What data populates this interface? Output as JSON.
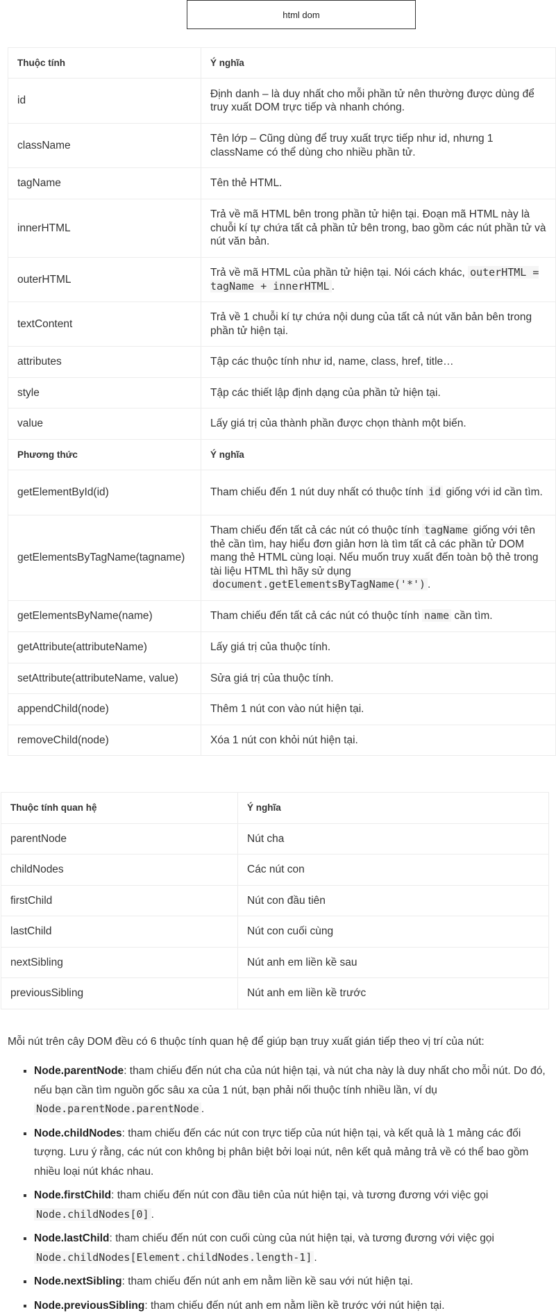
{
  "title": "html dom",
  "table1": {
    "header_props": [
      "Thuộc tính",
      "Ý nghĩa"
    ],
    "props": [
      {
        "name": "id",
        "desc": "Định danh – là duy nhất cho mỗi phần tử nên thường được dùng để truy xuất DOM trực tiếp và nhanh chóng."
      },
      {
        "name": "className",
        "desc": "Tên lớp – Cũng dùng để truy xuất trực tiếp như id, nhưng 1 className có thể dùng cho nhiều phần tử."
      },
      {
        "name": "tagName",
        "desc": "Tên thẻ HTML."
      },
      {
        "name": "innerHTML",
        "desc": "Trả về mã HTML bên trong phần tử hiện tại. Đoạn mã HTML này là chuỗi kí tự chứa tất cả phần tử bên trong, bao gồm các nút phần tử và nút văn bản."
      },
      {
        "name": "outerHTML",
        "desc_text": "Trả về mã HTML của phần tử hiện tại. Nói cách khác,",
        "desc_code": "outerHTML = tagName + innerHTML",
        "desc_after": "."
      },
      {
        "name": "textContent",
        "desc": "Trả về 1 chuỗi kí tự chứa nội dung của tất cả nút văn bản bên trong phần tử hiện tại."
      },
      {
        "name": "attributes",
        "desc": "Tập các thuộc tính như id, name, class, href, title…"
      },
      {
        "name": "style",
        "desc": "Tập các thiết lập định dạng của phần tử hiện tại."
      },
      {
        "name": "value",
        "desc": "Lấy giá trị của thành phần được chọn thành một biến."
      }
    ],
    "header_methods": [
      "Phương thức",
      "Ý nghĩa"
    ],
    "methods": [
      {
        "name": "getElementById(id)",
        "desc_text": "Tham chiếu đến 1 nút duy nhất có thuộc tính",
        "desc_code": "id",
        "desc_after": "giống với id cần tìm."
      },
      {
        "name": "getElementsByTagName(tagname)",
        "desc_text": "Tham chiếu đến tất cả các nút có thuộc tính",
        "desc_code": "tagName",
        "desc_after": "giống với tên thẻ cần tìm, hay hiểu đơn giản hơn là tìm tất cả các phần tử DOM mang thẻ HTML cùng loại. Nếu muốn truy xuất đến toàn bộ thẻ trong tài liệu HTML thì hãy sử dụng",
        "desc_code2": "document.getElementsByTagName('*')",
        "desc_end": "."
      },
      {
        "name": "getElementsByName(name)",
        "desc_text": "Tham chiếu đến tất cả các nút có thuộc tính",
        "desc_code": "name",
        "desc_after": "cần tìm."
      },
      {
        "name": "getAttribute(attributeName)",
        "desc": "Lấy giá trị của thuộc tính."
      },
      {
        "name": "setAttribute(attributeName, value)",
        "desc": "Sửa giá trị của thuộc tính."
      },
      {
        "name": "appendChild(node)",
        "desc": "Thêm 1 nút con vào nút hiện tại."
      },
      {
        "name": "removeChild(node)",
        "desc": "Xóa 1 nút con khỏi nút hiện tại."
      }
    ]
  },
  "table2": {
    "header": [
      "Thuộc tính quan hệ",
      "Ý nghĩa"
    ],
    "rows": [
      {
        "name": "parentNode",
        "desc": "Nút cha"
      },
      {
        "name": "childNodes",
        "desc": "Các nút con"
      },
      {
        "name": "firstChild",
        "desc": "Nút con đầu tiên"
      },
      {
        "name": "lastChild",
        "desc": "Nút con cuối cùng"
      },
      {
        "name": "nextSibling",
        "desc": "Nút anh em liền kề sau"
      },
      {
        "name": "previousSibling",
        "desc": "Nút anh em liền kề trước"
      }
    ]
  },
  "intro": "Mỗi nút trên cây DOM đều có 6 thuộc tính quan hệ để giúp bạn truy xuất gián tiếp theo vị trí của nút:",
  "bullets": [
    {
      "term": "Node.parentNode",
      "text": ": tham chiếu đến nút cha của nút hiện tại, và nút cha này là duy nhất cho mỗi nút. Do đó, nếu bạn cần tìm nguồn gốc sâu xa của 1 nút, bạn phải nối thuộc tính nhiều lần, ví dụ",
      "code": "Node.parentNode.parentNode",
      "after": "."
    },
    {
      "term": "Node.childNodes",
      "text": ": tham chiếu đến các nút con trực tiếp của nút hiện tại, và kết quả là 1 mảng các đối tượng. Lưu ý rằng, các nút con không bị phân biệt bởi loại nút, nên kết quả mảng trả về có thể bao gồm nhiều loại nút khác nhau.",
      "code": "",
      "after": ""
    },
    {
      "term": "Node.firstChild",
      "text": ": tham chiếu đến nút con đầu tiên của nút hiện tại, và tương đương với việc gọi",
      "code": "Node.childNodes[0]",
      "after": "."
    },
    {
      "term": "Node.lastChild",
      "text": ": tham chiếu đến nút con cuối cùng của nút hiện tại, và tương đương với việc gọi",
      "code": "Node.childNodes[Element.childNodes.length-1]",
      "after": "."
    },
    {
      "term": "Node.nextSibling",
      "text": ": tham chiếu đến nút anh em nằm liền kề sau với nút hiện tại.",
      "code": "",
      "after": ""
    },
    {
      "term": "Node.previousSibling",
      "text": ": tham chiếu đến nút anh em nằm liền kề trước với nút hiện tại.",
      "code": "",
      "after": ""
    }
  ]
}
